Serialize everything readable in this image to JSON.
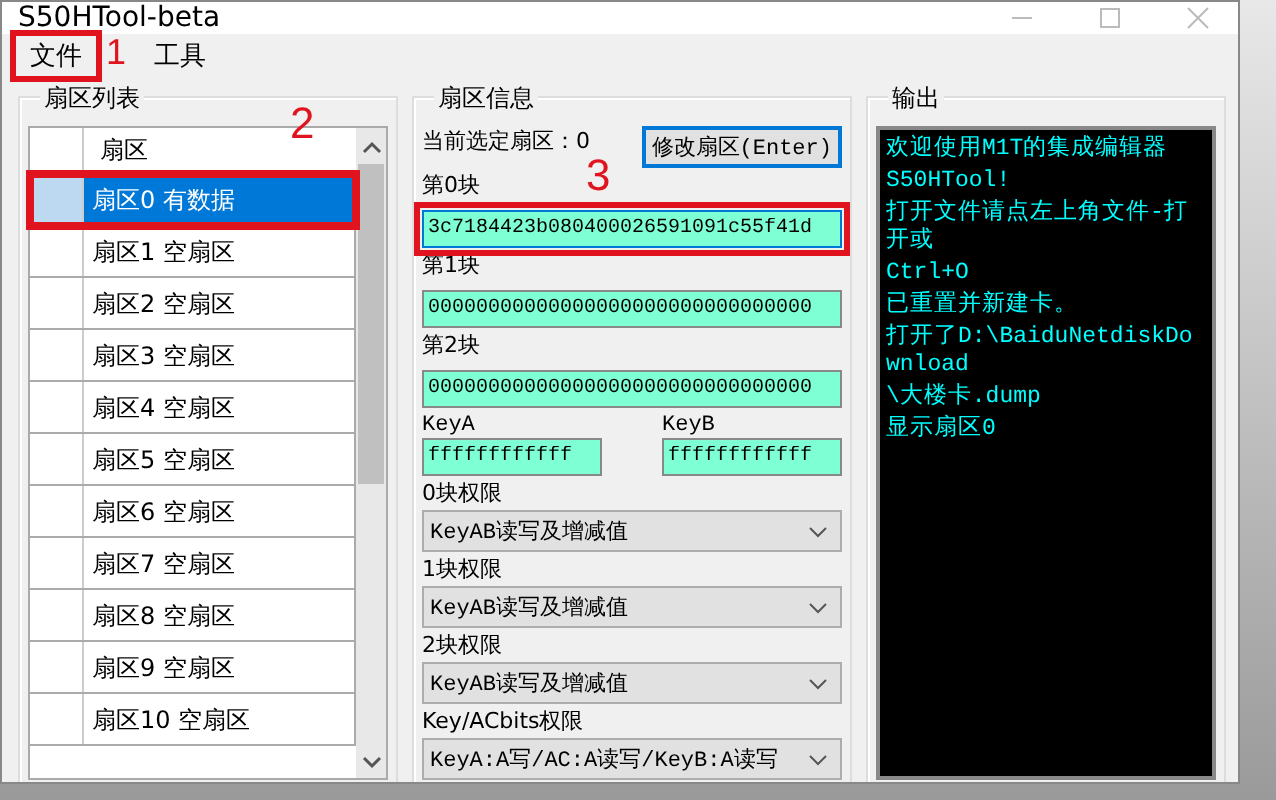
{
  "window": {
    "title": "S50HTool-beta"
  },
  "menu": [
    {
      "label": "文件",
      "marker": "1"
    },
    {
      "label": "工具"
    }
  ],
  "sector_list": {
    "title": "扇区列表",
    "column": "扇区",
    "rows": [
      {
        "label": "扇区0 有数据",
        "selected": true,
        "marker": "2"
      },
      {
        "label": "扇区1 空扇区",
        "selected": false
      },
      {
        "label": "扇区2 空扇区",
        "selected": false
      },
      {
        "label": "扇区3 空扇区",
        "selected": false
      },
      {
        "label": "扇区4 空扇区",
        "selected": false
      },
      {
        "label": "扇区5 空扇区",
        "selected": false
      },
      {
        "label": "扇区6 空扇区",
        "selected": false
      },
      {
        "label": "扇区7 空扇区",
        "selected": false
      },
      {
        "label": "扇区8 空扇区",
        "selected": false
      },
      {
        "label": "扇区9 空扇区",
        "selected": false
      },
      {
        "label": "扇区10 空扇区",
        "selected": false
      }
    ]
  },
  "sector_info": {
    "title": "扇区信息",
    "current_label": "当前选定扇区：0",
    "edit_button": "修改扇区(Enter)",
    "blocks": [
      {
        "label": "第0块",
        "value": "3c7184423b080400026591091c55f41d",
        "focused": true,
        "marker": "3"
      },
      {
        "label": "第1块",
        "value": "00000000000000000000000000000000",
        "focused": false
      },
      {
        "label": "第2块",
        "value": "00000000000000000000000000000000",
        "focused": false
      }
    ],
    "key_a": {
      "label": "KeyA",
      "value": "ffffffffffff"
    },
    "key_b": {
      "label": "KeyB",
      "value": "ffffffffffff"
    },
    "permissions": [
      {
        "label": "0块权限",
        "value": "KeyAB读写及增减值"
      },
      {
        "label": "1块权限",
        "value": "KeyAB读写及增减值"
      },
      {
        "label": "2块权限",
        "value": "KeyAB读写及增减值"
      },
      {
        "label": "Key/ACbits权限",
        "value": "KeyA:A写/AC:A读写/KeyB:A读写"
      }
    ]
  },
  "output": {
    "title": "输出",
    "lines": [
      "欢迎使用M1T的集成编辑器",
      "S50HTool!",
      "打开文件请点左上角文件-打开或",
      "Ctrl+O",
      "已重置并新建卡。",
      "打开了D:\\BaiduNetdiskDownload",
      "\\大楼卡.dump",
      "显示扇区0"
    ]
  }
}
